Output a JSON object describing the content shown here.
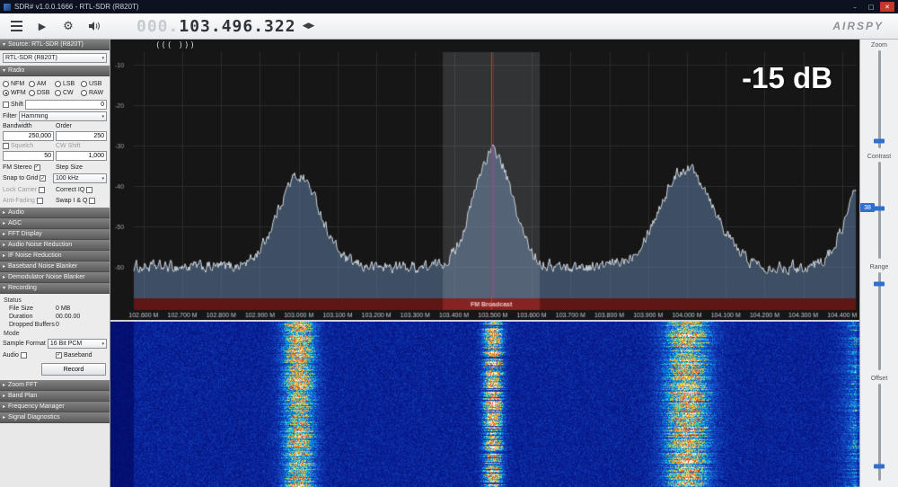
{
  "colors": {
    "accent_blue": "#2f6fd0",
    "tune_line": "#e03030",
    "band_strip": "#611616",
    "signal_fill": "rgba(98,128,164,0.55)"
  },
  "window": {
    "title": "SDR# v1.0.0.1666 - RTL-SDR (R820T)",
    "minimize": "–",
    "maximize": "□",
    "close": "✕"
  },
  "toolbar": {
    "frequency": {
      "dim_prefix": "000.",
      "main": "103.496.322"
    },
    "tune_arrows": "◀▶",
    "brand": "AIRSPY"
  },
  "icons": {
    "chevron_collapsed": "▸",
    "chevron_expanded": "▾"
  },
  "sidebar": {
    "source": {
      "header": "Source: RTL-SDR (R820T)",
      "device": "RTL-SDR (R820T)"
    },
    "radio": {
      "header": "Radio",
      "modes": [
        {
          "label": "NFM",
          "selected": false
        },
        {
          "label": "AM",
          "selected": false
        },
        {
          "label": "LSB",
          "selected": false
        },
        {
          "label": "USB",
          "selected": false
        },
        {
          "label": "WFM",
          "selected": true
        },
        {
          "label": "DSB",
          "selected": false
        },
        {
          "label": "CW",
          "selected": false
        },
        {
          "label": "RAW",
          "selected": false
        }
      ],
      "shift": {
        "label": "Shift",
        "checked": false,
        "value": "0"
      },
      "filter": {
        "label": "Filter",
        "value": "Hamming"
      },
      "bandwidth": {
        "label": "Bandwidth",
        "value": "250,000"
      },
      "order": {
        "label": "Order",
        "value": "250"
      },
      "squelch": {
        "label": "Squelch",
        "checked": false,
        "value": "50"
      },
      "cw_shift": {
        "label": "CW Shift",
        "value": "1,000"
      },
      "fm_stereo": {
        "label": "FM Stereo",
        "checked": true
      },
      "step_size": {
        "label": "Step Size"
      },
      "snap": {
        "label": "Snap to Grid",
        "checked": true,
        "value": "100 kHz"
      },
      "lock_carrier": {
        "label": "Lock Carrier",
        "checked": false
      },
      "correct_iq": {
        "label": "Correct IQ",
        "checked": false
      },
      "anti_fading": {
        "label": "Anti-Fading",
        "checked": false
      },
      "swap_iq": {
        "label": "Swap I & Q",
        "checked": false
      }
    },
    "collapsed_panels": [
      "Audio",
      "AGC",
      "FFT Display",
      "Audio Noise Reduction",
      "IF Noise Reduction",
      "Baseband Noise Blanker",
      "Demodulator Noise Blanker"
    ],
    "recording": {
      "header": "Recording",
      "status_label": "Status",
      "rows": [
        {
          "label": "File Size",
          "value": "0 MB"
        },
        {
          "label": "Duration",
          "value": "00.00.00"
        },
        {
          "label": "Dropped Buffers",
          "value": "0"
        }
      ],
      "mode_label": "Mode",
      "sample_format": {
        "label": "Sample Format",
        "value": "16 Bit PCM"
      },
      "audio": {
        "label": "Audio",
        "checked": false
      },
      "baseband": {
        "label": "Baseband",
        "checked": true
      },
      "record_button": "Record"
    },
    "bottom_panels": [
      "Zoom FFT",
      "Band Plan",
      "Frequency Manager",
      "Signal Diagnostics"
    ]
  },
  "right_panel": {
    "sliders": [
      {
        "label": "Zoom",
        "pos": 0.93
      },
      {
        "label": "Contrast",
        "pos": 0.48
      },
      {
        "label": "Range",
        "pos": 0.12
      },
      {
        "label": "Offset",
        "pos": 0.85
      }
    ],
    "value_badge": "38"
  },
  "spectrum_overlays": {
    "osd_db": "-15 dB",
    "tuning_marks": "((( )))"
  },
  "chart_data": {
    "type": "spectrum",
    "freq_min_mhz": 102.575,
    "freq_max_mhz": 104.435,
    "freq_tick_start_mhz": 102.6,
    "freq_tick_step_mhz": 0.1,
    "freq_tick_labels": [
      "102.600 M",
      "102.700 M",
      "102.800 M",
      "102.900 M",
      "103.000 M",
      "103.100 M",
      "103.200 M",
      "103.300 M",
      "103.400 M",
      "103.500 M",
      "103.600 M",
      "103.700 M",
      "103.800 M",
      "103.900 M",
      "104.000 M",
      "104.100 M",
      "104.200 M",
      "104.300 M",
      "104.400 M"
    ],
    "db_ticks": [
      -10,
      -20,
      -30,
      -40,
      -50,
      -60
    ],
    "noise_floor_db": -60,
    "peaks": [
      {
        "freq_mhz": 103.0,
        "peak_db": -37.5,
        "width_mhz": 0.055
      },
      {
        "freq_mhz": 103.5,
        "peak_db": -31.5,
        "width_mhz": 0.05
      },
      {
        "freq_mhz": 104.0,
        "peak_db": -35.5,
        "width_mhz": 0.07
      },
      {
        "freq_mhz": 104.465,
        "peak_db": -37.0,
        "width_mhz": 0.05
      }
    ],
    "tuned_freq_mhz": 103.496,
    "selection_bandwidth_mhz": 0.25,
    "band_label": "FM Broadcast",
    "waterfall_streaks": [
      {
        "freq_mhz": 103.0,
        "intensity": 0.52,
        "width_mhz": 0.03
      },
      {
        "freq_mhz": 103.5,
        "intensity": 0.64,
        "width_mhz": 0.018
      },
      {
        "freq_mhz": 104.0,
        "intensity": 0.56,
        "width_mhz": 0.042
      },
      {
        "freq_mhz": 104.465,
        "intensity": 0.36,
        "width_mhz": 0.04
      }
    ]
  }
}
